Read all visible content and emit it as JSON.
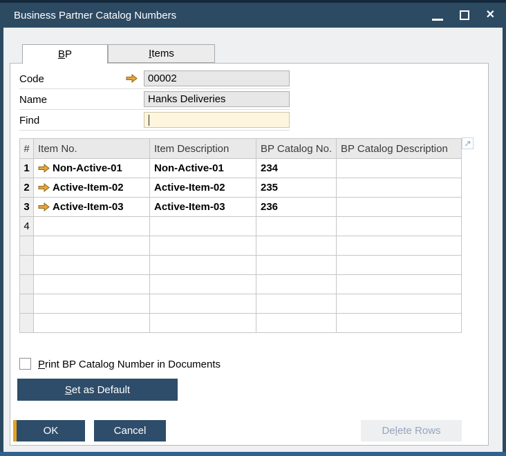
{
  "window": {
    "title": "Business Partner Catalog Numbers"
  },
  "tabs": {
    "bp": {
      "pre": "",
      "key": "B",
      "post": "P"
    },
    "items": {
      "pre": "",
      "key": "I",
      "post": "tems"
    }
  },
  "form": {
    "code_label": "Code",
    "code_value": "00002",
    "name_label": "Name",
    "name_value": "Hanks Deliveries",
    "find_label": "Find",
    "find_value": ""
  },
  "table": {
    "headers": {
      "num": "#",
      "item_no": "Item No.",
      "item_desc": "Item Description",
      "bp_catalog_no": "BP Catalog No.",
      "bp_catalog_desc": "BP Catalog Description"
    },
    "rows": [
      {
        "num": "1",
        "item_no": "Non-Active-01",
        "item_desc": "Non-Active-01",
        "bp_catalog_no": "234",
        "bp_catalog_desc": ""
      },
      {
        "num": "2",
        "item_no": "Active-Item-02",
        "item_desc": "Active-Item-02",
        "bp_catalog_no": "235",
        "bp_catalog_desc": ""
      },
      {
        "num": "3",
        "item_no": "Active-Item-03",
        "item_desc": "Active-Item-03",
        "bp_catalog_no": "236",
        "bp_catalog_desc": ""
      },
      {
        "num": "4",
        "item_no": "",
        "item_desc": "",
        "bp_catalog_no": "",
        "bp_catalog_desc": ""
      }
    ],
    "expand_icon": "↗"
  },
  "checkbox": {
    "checked": false,
    "label": {
      "pre": "",
      "key": "P",
      "post": "rint BP Catalog Number in Documents"
    }
  },
  "buttons": {
    "set_default": {
      "pre": "",
      "key": "S",
      "post": "et as Default"
    },
    "ok": "OK",
    "cancel": "Cancel",
    "delete_rows": {
      "pre": "De",
      "key": "l",
      "post": "ete Rows"
    }
  },
  "colors": {
    "titlebar": "#2d4a63",
    "button_blue": "#2e4d6a",
    "accent_gold": "#e0a225",
    "find_field_bg": "#fdf5dd",
    "disabled_text": "#97a5ba"
  }
}
